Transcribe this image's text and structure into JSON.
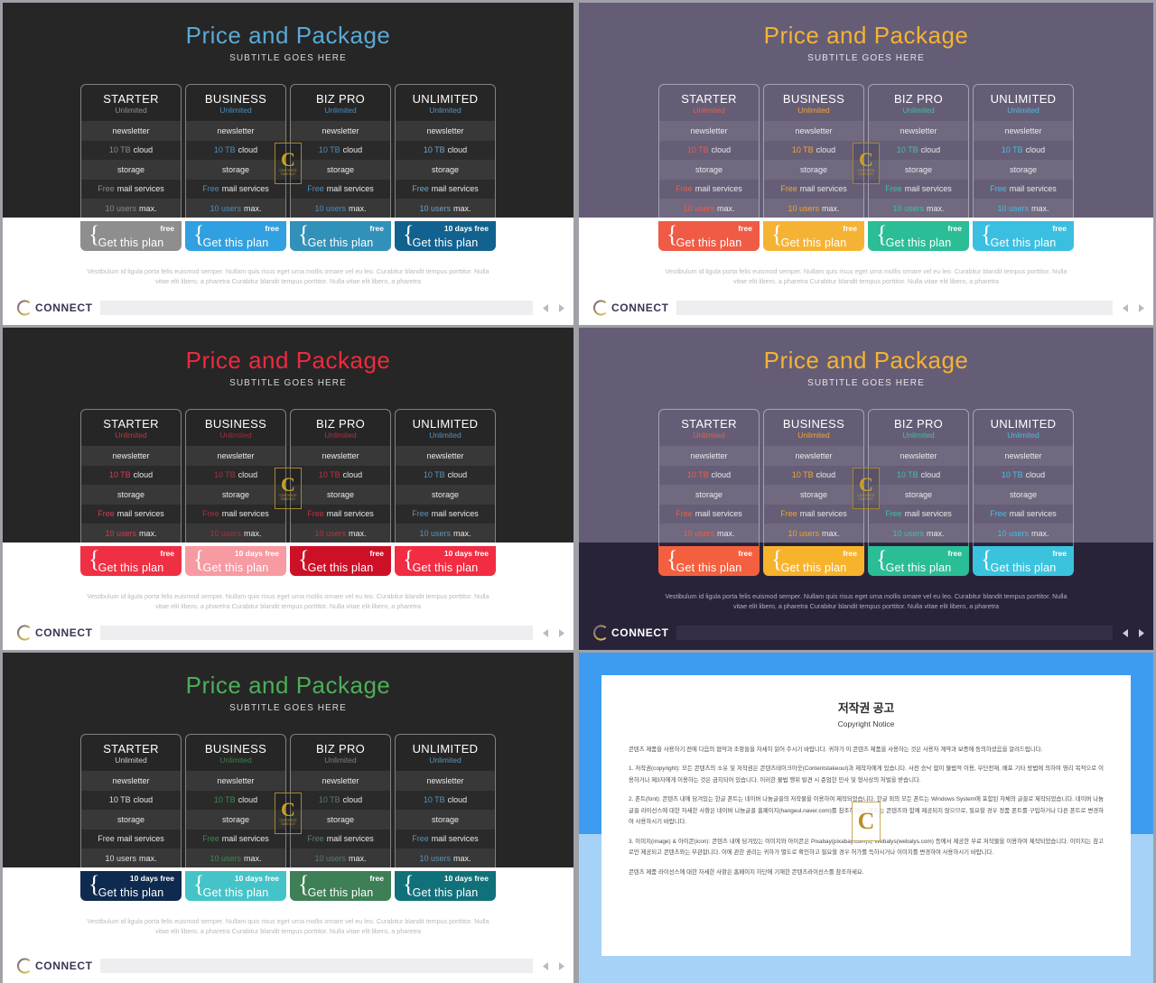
{
  "slide": {
    "title": "Price and Package",
    "subtitle": "SUBTITLE GOES HERE",
    "lorem": "Vestibulum id ligula porta felis euismod semper. Nullam quis risus eget urna mollis ornare vel eu leo. Curabitur blandit tempus porttitor. Nulla vitae elit libero, a pharetra  Curabitur blandit tempus porttitor. Nulla vitae elit libero, a pharetra",
    "watermark": {
      "letter": "C",
      "caption": "CONTENTS TAKEOUT"
    }
  },
  "footer": {
    "brand": "CONNECT",
    "prev_icon": "triangle-left-icon",
    "next_icon": "triangle-right-icon"
  },
  "plans": {
    "names": [
      "STARTER",
      "BUSINESS",
      "BIZ PRO",
      "UNLIMITED"
    ],
    "tagline": "Unlimited",
    "features": [
      "newsletter",
      "10 TB cloud",
      "storage",
      "Free mail services",
      "10 users max."
    ],
    "feature_highlight_words": [
      "",
      "10 TB",
      "",
      "Free",
      "10 users"
    ],
    "cta_label": "Get this plan",
    "brace_glyph": "{"
  },
  "variants": [
    {
      "id": "blue-on-dark",
      "theme": "th-dark",
      "title_color": "#5aa9d6",
      "tagline_colors": [
        "#8f8f8f",
        "#4a8fbf",
        "#4a8fbf",
        "#5b93b8"
      ],
      "highlight_colors": [
        "#8a8a8a",
        "#4a8fbf",
        "#4a8fbf",
        "#6fa3c4"
      ],
      "buttons": [
        {
          "color": "#8e8e8e",
          "free_label": "free"
        },
        {
          "color": "#30a0e0",
          "free_label": "free"
        },
        {
          "color": "#3191b9",
          "free_label": "free"
        },
        {
          "color": "#11628f",
          "free_label": "10 days free"
        }
      ]
    },
    {
      "id": "multicolor-on-purple",
      "theme": "th-purple",
      "title_color": "#f5b335",
      "tagline_colors": [
        "#ef5b45",
        "#f0a62e",
        "#3fc1a0",
        "#49bde0"
      ],
      "highlight_colors": [
        "#ef5b45",
        "#f0a62e",
        "#3fc1a0",
        "#49bde0"
      ],
      "buttons": [
        {
          "color": "#ef5b45",
          "free_label": "free"
        },
        {
          "color": "#f5b335",
          "free_label": "free"
        },
        {
          "color": "#2bbd96",
          "free_label": "free"
        },
        {
          "color": "#3bbfe0",
          "free_label": "free"
        }
      ]
    },
    {
      "id": "red-on-dark",
      "theme": "th-dark",
      "title_color": "#ee2b3e",
      "tagline_colors": [
        "#c33",
        "#a22b38",
        "#b03040",
        "#5b93b8"
      ],
      "highlight_colors": [
        "#d93a4c",
        "#a8303e",
        "#c1303f",
        "#5b93b8"
      ],
      "buttons": [
        {
          "color": "#ef3044",
          "free_label": "free"
        },
        {
          "color": "#f79aa2",
          "free_label": "10 days free"
        },
        {
          "color": "#cc1127",
          "free_label": "free"
        },
        {
          "color": "#f22c42",
          "free_label": "10 days free"
        }
      ]
    },
    {
      "id": "multicolor-on-purple-dark",
      "theme": "th-purpledark",
      "title_color": "#f5b335",
      "tagline_colors": [
        "#ef5b45",
        "#f0a62e",
        "#3fc1a0",
        "#49bde0"
      ],
      "highlight_colors": [
        "#ef5b45",
        "#f0a62e",
        "#3fc1a0",
        "#49bde0"
      ],
      "buttons": [
        {
          "color": "#f4603f",
          "free_label": "free"
        },
        {
          "color": "#f8b32c",
          "free_label": "free"
        },
        {
          "color": "#2bbd96",
          "free_label": "free"
        },
        {
          "color": "#3bc3de",
          "free_label": "free"
        }
      ]
    },
    {
      "id": "green-teal-on-dark",
      "theme": "th-dark",
      "title_color": "#4caf58",
      "tagline_colors": [
        "#cfcfcf",
        "#3f7f46",
        "#7d7d7d",
        "#5b93b8"
      ],
      "highlight_colors": [
        "#dcdcdc",
        "#3f8a49",
        "#587d72",
        "#5b93b8"
      ],
      "buttons": [
        {
          "color": "#0e2a4e",
          "free_label": "10 days free"
        },
        {
          "color": "#44c4c9",
          "free_label": "10 days free"
        },
        {
          "color": "#3e7f56",
          "free_label": "free"
        },
        {
          "color": "#11717a",
          "free_label": "10 days free"
        }
      ]
    }
  ],
  "copyright": {
    "title": "저작권 공고",
    "subtitle": "Copyright Notice",
    "paragraphs": [
      "콘텐츠 제품을 사용하기 전에 다음의 협약과 조항들을 자세히 읽어 주시기 바랍니다. 귀하가 이 콘텐츠 제품을 사용하는 것은 사용자 계약과 보증에 동의하셨음을 알려드립니다.",
      "1. 저작권(copyright): 모든 콘텐츠의 소유 및 저작권은 콘텐츠테이크아웃(Contentstakeout)과 제작자에게 있습니다. 사전 승낙 없이 불법적 이용, 무단전재, 배포 기타 방법에 의하여 영리 목적으로 이용하거나 제3자에게 이용하는 것은 금지되어 있습니다. 이러한 불법 행위 발견 시 준엄한 민사 및 형사상의 처벌을 받습니다.",
      "2. 폰트(font): 콘텐츠 내에 담겨있는 한글 폰트는 네이버 나눔글꼴의 저작물을 이용하여 제작되었습니다. 한글 외의 모든 폰트는 Windows System에 포함된 자체의 글꼴로 제작되었습니다. 네이버 나눔글꼴 라이선스에 대한 자세한 사항은 네이버 나눔글꼴 홈페이지(hangeul.naver.com)를 참조하세요. 폰트는 콘텐츠와 함께 제공되지 않으므로, 필요할 경우 정품 폰트를 구입하거나 다른 폰트로 변경하여 사용하시기 바랍니다.",
      "3. 이미지(image) & 아이콘(icon): 콘텐츠 내에 담겨있는 이미지와 아이콘은 Pixabay(pixabay.com)와 Webalys(webalys.com) 등에서 제공한 무료 저작물을 이용하여 제작되었습니다. 이미지는 참고로만 제공되고 콘텐츠와는 무관합니다. 이에 관한 권리는 귀하가 별도로 확인하고 필요할 경우 허가를 득하시거나 이미지를 변경하여 사용하시기 바랍니다.",
      "콘텐츠 제품 라이선스에 대한 자세한 사항은 홈페이지 하단에 기재한 콘텐츠라이선스를 참조하세요."
    ],
    "watermark_letter": "C"
  }
}
